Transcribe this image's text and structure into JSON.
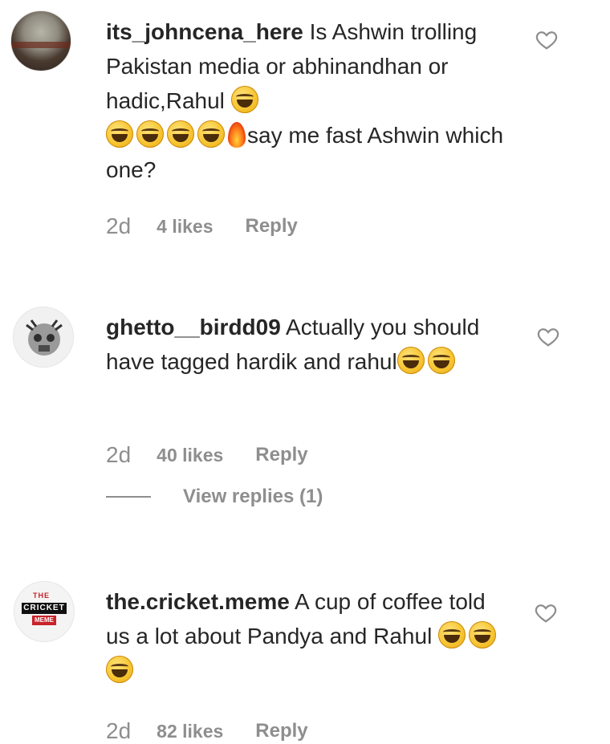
{
  "comments": [
    {
      "username": "its_johncena_here",
      "text_parts": [
        "Is Ashwin trolling Pakistan media or abhinandhan or hadic,Rahul ",
        "say me fast Ashwin which one?"
      ],
      "emojis_line1": [
        "face-with-tears-of-joy-emoji"
      ],
      "emojis_line2": [
        "face-with-tears-of-joy-emoji",
        "face-with-tears-of-joy-emoji",
        "face-with-tears-of-joy-emoji",
        "face-with-tears-of-joy-emoji",
        "fire-emoji"
      ],
      "time": "2d",
      "likes": "4 likes",
      "reply": "Reply"
    },
    {
      "username": "ghetto__birdd09",
      "text": "Actually you should have tagged hardik and rahul",
      "emojis": [
        "face-with-tears-of-joy-emoji",
        "face-with-tears-of-joy-emoji"
      ],
      "time": "2d",
      "likes": "40 likes",
      "reply": "Reply",
      "view_replies": "View replies (1)"
    },
    {
      "username": "the.cricket.meme",
      "text": "A cup of coffee told us a lot about Pandya and Rahul",
      "emojis": [
        "face-with-tears-of-joy-emoji",
        "face-with-tears-of-joy-emoji",
        "face-with-tears-of-joy-emoji"
      ],
      "avatar_badge": {
        "top": "THE",
        "middle": "CRICKET",
        "bottom": "MEME"
      },
      "time": "2d",
      "likes": "82 likes",
      "reply": "Reply"
    }
  ],
  "colors": {
    "text": "#262626",
    "muted": "#8e8e8e",
    "badge_red": "#c9232b"
  },
  "icons": {
    "like": "heart-outline-icon"
  }
}
